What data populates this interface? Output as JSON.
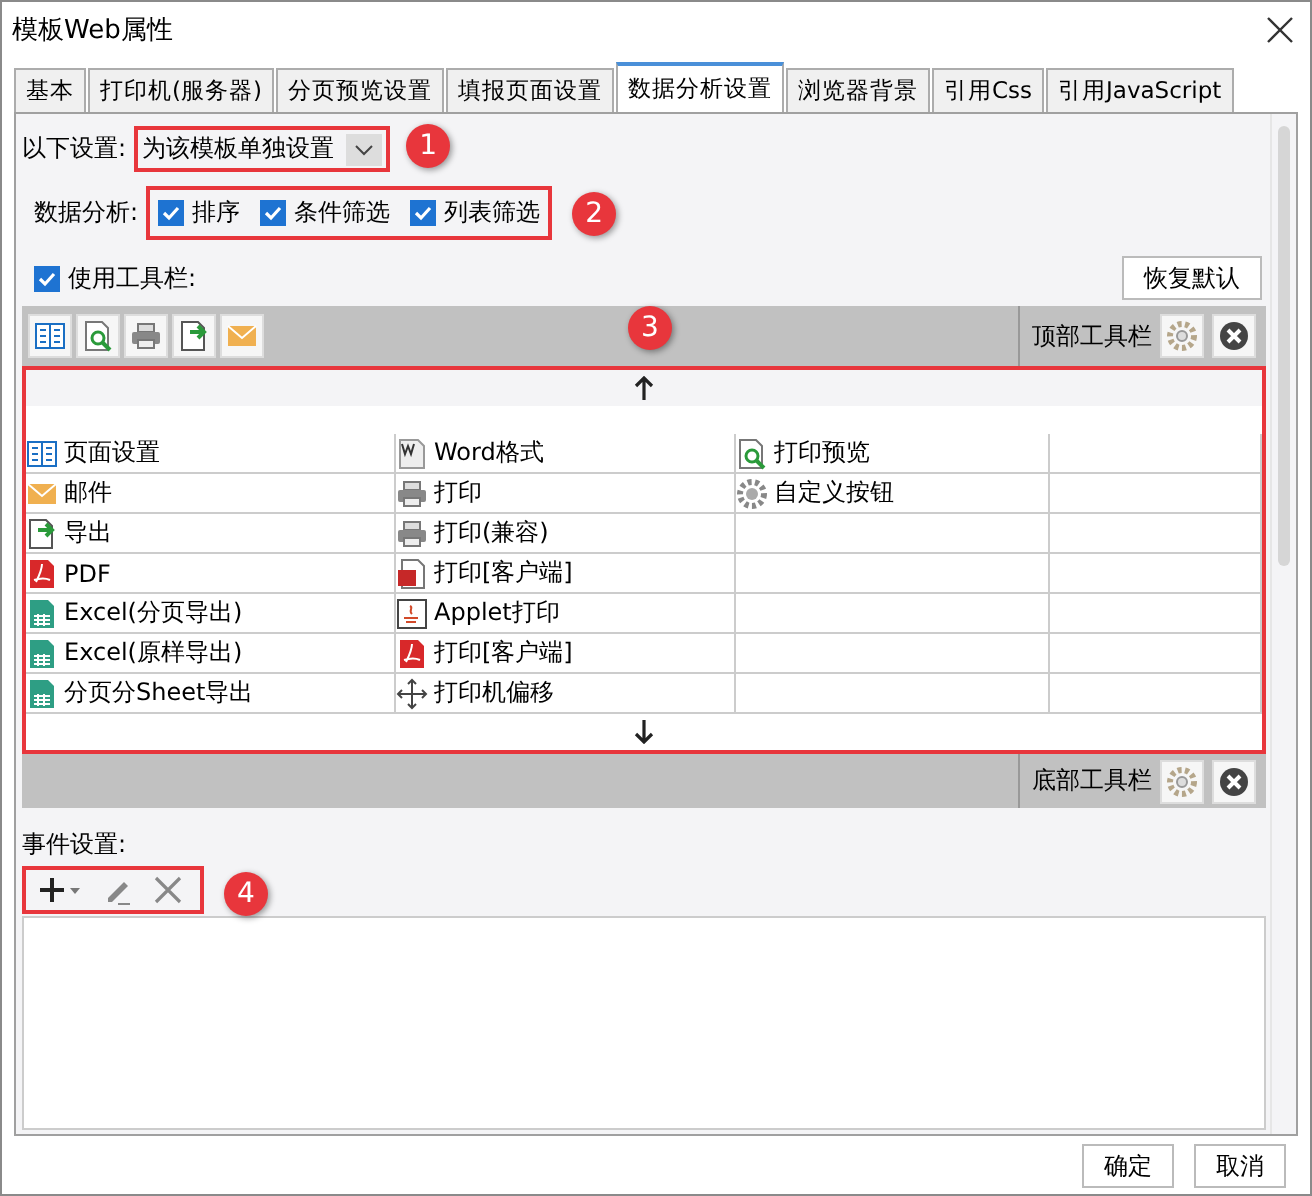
{
  "window": {
    "title": "模板Web属性"
  },
  "tabs": [
    {
      "label": "基本",
      "selected": false
    },
    {
      "label": "打印机(服务器)",
      "selected": false
    },
    {
      "label": "分页预览设置",
      "selected": false
    },
    {
      "label": "填报页面设置",
      "selected": false
    },
    {
      "label": "数据分析设置",
      "selected": true
    },
    {
      "label": "浏览器背景",
      "selected": false
    },
    {
      "label": "引用Css",
      "selected": false
    },
    {
      "label": "引用JavaScript",
      "selected": false
    }
  ],
  "scope": {
    "label": "以下设置:",
    "value": "为该模板单独设置",
    "callout": "1"
  },
  "analysis": {
    "label": "数据分析:",
    "callout": "2",
    "options": [
      {
        "label": "排序",
        "checked": true
      },
      {
        "label": "条件筛选",
        "checked": true
      },
      {
        "label": "列表筛选",
        "checked": true
      }
    ]
  },
  "use_toolbar": {
    "label": "使用工具栏:",
    "checked": true
  },
  "restore_button": "恢复默认",
  "top_toolbar": {
    "label": "顶部工具栏",
    "callout": "3",
    "buttons": [
      {
        "kind": "layout"
      },
      {
        "kind": "preview"
      },
      {
        "kind": "print"
      },
      {
        "kind": "export"
      },
      {
        "kind": "mail"
      }
    ]
  },
  "button_grid": {
    "rows": [
      [
        {
          "kind": "layout",
          "label": "页面设置"
        },
        {
          "kind": "word",
          "label": "Word格式"
        },
        {
          "kind": "preview",
          "label": "打印预览"
        }
      ],
      [
        {
          "kind": "mail",
          "label": "邮件"
        },
        {
          "kind": "print",
          "label": "打印"
        },
        {
          "kind": "gear",
          "label": "自定义按钮"
        }
      ],
      [
        {
          "kind": "export",
          "label": "导出"
        },
        {
          "kind": "print",
          "label": "打印(兼容)"
        }
      ],
      [
        {
          "kind": "pdf",
          "label": "PDF"
        },
        {
          "kind": "flash",
          "label": "打印[客户端]"
        }
      ],
      [
        {
          "kind": "excel",
          "label": "Excel(分页导出)"
        },
        {
          "kind": "applet",
          "label": "Applet打印"
        }
      ],
      [
        {
          "kind": "excel",
          "label": "Excel(原样导出)"
        },
        {
          "kind": "pdf",
          "label": "打印[客户端]"
        }
      ],
      [
        {
          "kind": "excel",
          "label": "分页分Sheet导出"
        },
        {
          "kind": "move",
          "label": "打印机偏移"
        }
      ]
    ]
  },
  "bottom_toolbar": {
    "label": "底部工具栏"
  },
  "events": {
    "label": "事件设置:",
    "callout": "4"
  },
  "footer_buttons": [
    "确定",
    "取消"
  ]
}
